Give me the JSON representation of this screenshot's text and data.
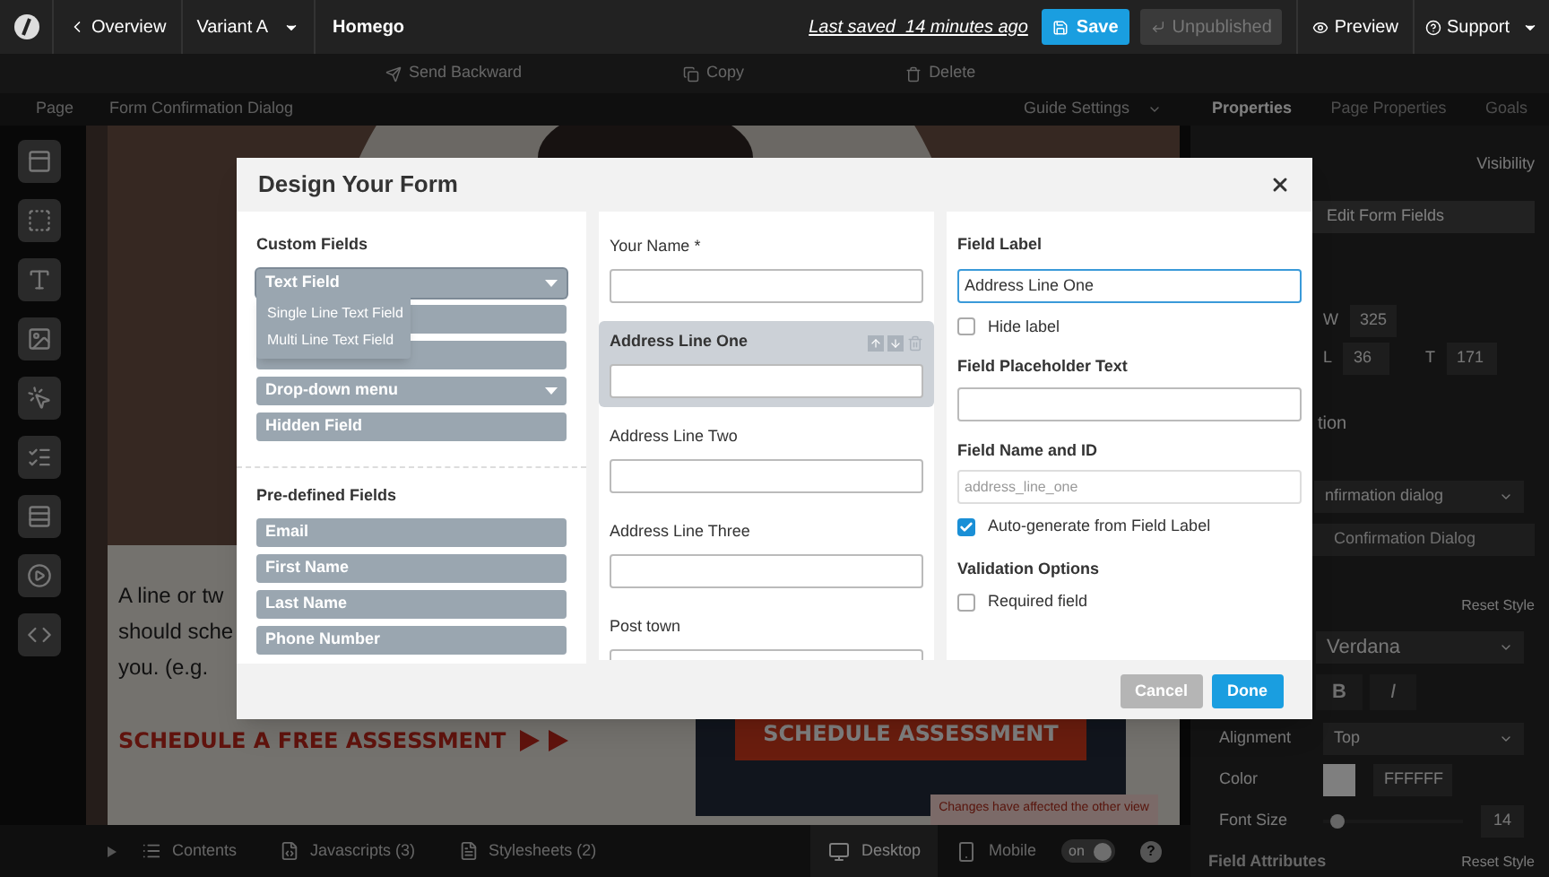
{
  "top_bar": {
    "back": "Overview",
    "variant": "Variant A",
    "page_name": "Homego",
    "last_saved": "Last saved  14 minutes ago",
    "save": "Save",
    "unpublished": "Unpublished",
    "preview": "Preview",
    "support": "Support"
  },
  "toolbar": [
    "Send Backward",
    "Copy",
    "Delete"
  ],
  "subheader": {
    "crumbs": [
      "Page",
      "Form Confirmation Dialog"
    ],
    "guide_settings": "Guide Settings"
  },
  "panel_tabs": [
    {
      "label": "Properties",
      "selected": true
    },
    {
      "label": "Page Properties",
      "selected": false
    },
    {
      "label": "Goals",
      "selected": false
    }
  ],
  "canvas": {
    "body_lines": [
      "A line or tw",
      "should sche",
      "you. (e.g."
    ],
    "link": "SCHEDULE A FREE ASSESSMENT",
    "button": "SCHEDULE ASSESSMENT",
    "notice": "Changes have affected the other view"
  },
  "properties": {
    "visibility": "Visibility",
    "edit_button": "Edit Form Fields",
    "w_label": "W",
    "w": "325",
    "l_label": "L",
    "l": "36",
    "t_label": "T",
    "t": "171",
    "section_tail": "tion",
    "dialog_select": "nfirmation dialog",
    "dialog_button": "Confirmation Dialog",
    "reset_style": "Reset Style",
    "font": "Verdana",
    "bold": "B",
    "italic": "I",
    "alignment_label": "Alignment",
    "alignment": "Top",
    "color_label": "Color",
    "color_value": "FFFFFF",
    "font_size_label": "Font Size",
    "font_size": "14",
    "font_size_slider": {
      "level": 0.05
    },
    "attributes": "Field Attributes",
    "attributes_reset": "Reset Style"
  },
  "bottom_bar": {
    "contents": "Contents",
    "javascripts": "Javascripts (3)",
    "stylesheets": "Stylesheets (2)",
    "views": [
      {
        "label": "Desktop",
        "selected": true
      },
      {
        "label": "Mobile",
        "selected": false
      }
    ],
    "toggle": {
      "label": "on",
      "on": true
    },
    "help": "?"
  },
  "dialog": {
    "title": "Design Your Form",
    "custom_heading": "Custom Fields",
    "custom_fields": [
      {
        "label": "Text Field",
        "kind": "dropdown",
        "expanded": true
      },
      {
        "kind": "hidden"
      },
      {
        "kind": "hidden"
      },
      {
        "label": "Drop-down menu",
        "kind": "dropdown",
        "expanded": false
      },
      {
        "label": "Hidden Field",
        "kind": "plain"
      }
    ],
    "menu": [
      "Single Line Text Field",
      "Multi Line Text Field"
    ],
    "predefined_heading": "Pre-defined Fields",
    "predefined_fields": [
      "Email",
      "First Name",
      "Last Name",
      "Phone Number"
    ],
    "form_fields": [
      {
        "label": "Your Name *",
        "selected": false
      },
      {
        "label": "Address Line One",
        "selected": true
      },
      {
        "label": "Address Line Two",
        "selected": false
      },
      {
        "label": "Address Line Three",
        "selected": false
      },
      {
        "label": "Post town",
        "selected": false
      }
    ],
    "field_label": {
      "heading": "Field Label",
      "value": "Address Line One"
    },
    "hide_label": {
      "label": "Hide label",
      "checked": false
    },
    "placeholder_heading": "Field Placeholder Text",
    "name_id": {
      "heading": "Field Name and ID",
      "placeholder": "address_line_one"
    },
    "auto_generate": {
      "label": "Auto-generate from Field Label",
      "checked": true
    },
    "validation_heading": "Validation Options",
    "required": {
      "label": "Required field",
      "checked": false
    },
    "cancel": "Cancel",
    "done": "Done"
  }
}
